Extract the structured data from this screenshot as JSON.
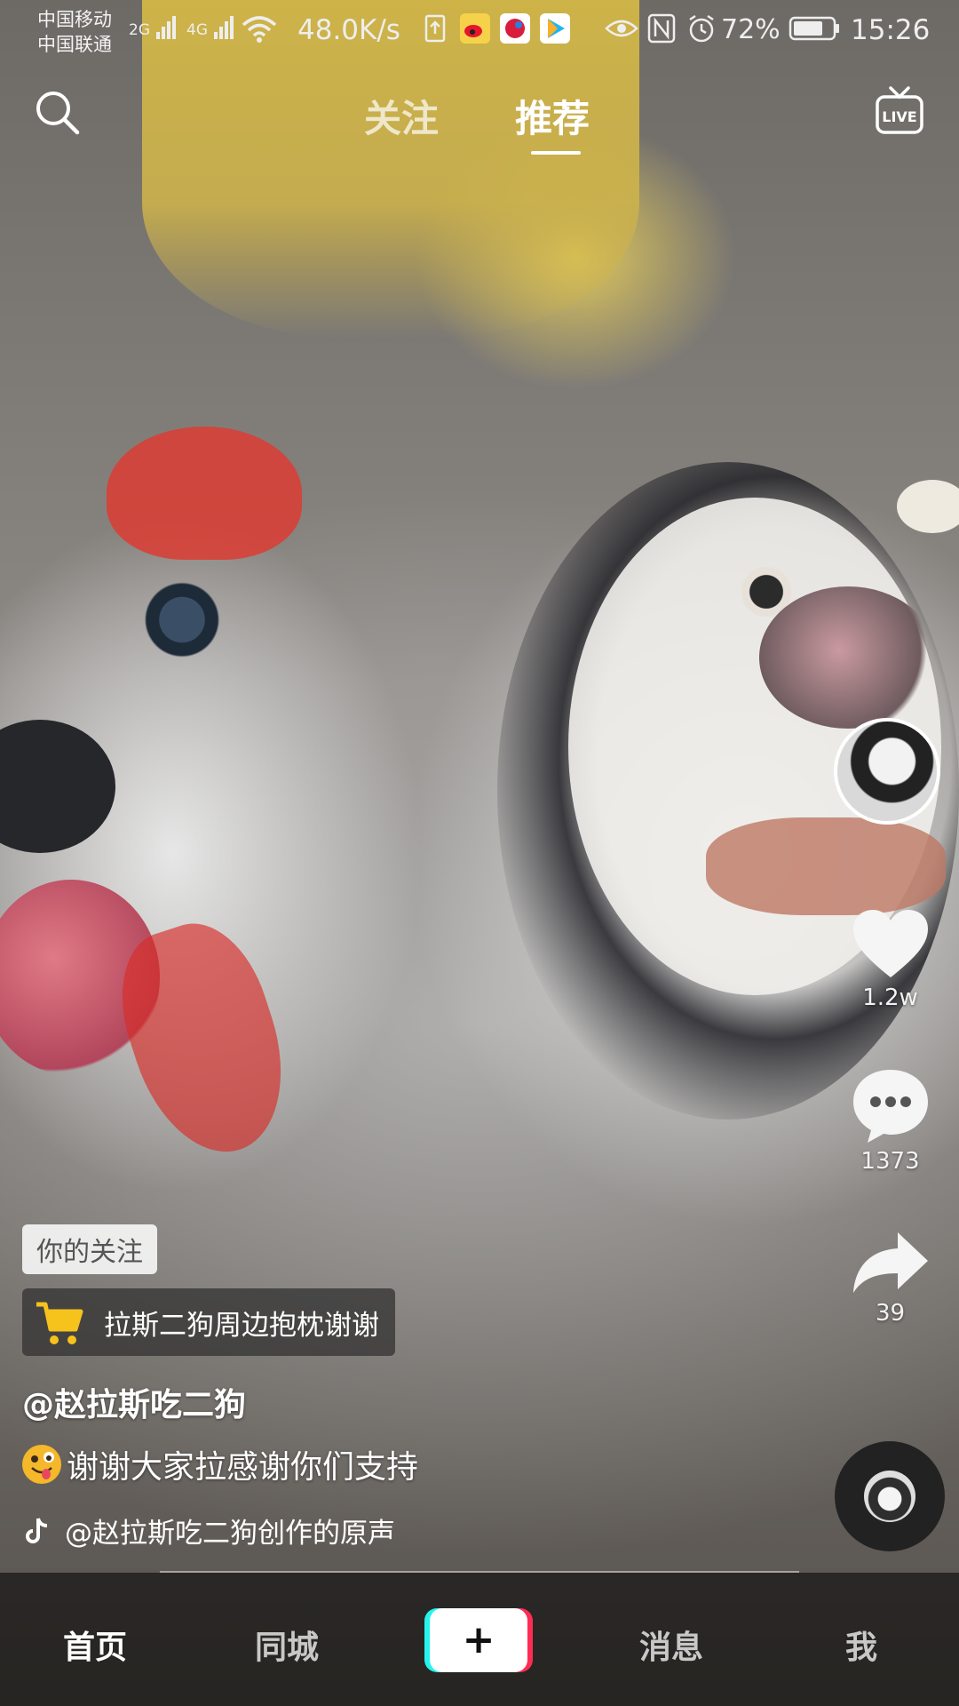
{
  "status_bar": {
    "carrier_1": "中国移动",
    "carrier_2": "中国联通",
    "sim1_net": "2G",
    "sim2_net": "4G",
    "net_speed": "48.0K/s",
    "battery_percent": "72%",
    "time": "15:26",
    "icons": [
      "wifi-icon",
      "upload-icon",
      "weibo-icon",
      "notification-app-icon",
      "video-app-icon",
      "eye-icon",
      "nfc-icon",
      "alarm-icon",
      "battery-icon"
    ]
  },
  "top_nav": {
    "tabs": [
      {
        "label": "关注",
        "active": false
      },
      {
        "label": "推荐",
        "active": true
      }
    ],
    "search_icon": "search-icon",
    "live_icon": "live-icon",
    "live_label": "LIVE"
  },
  "right_rail": {
    "like_count": "1.2w",
    "comment_count": "1373",
    "share_count": "39"
  },
  "video_info": {
    "follow_tag": "你的关注",
    "shop_label": "拉斯二狗周边抱枕谢谢",
    "username": "@赵拉斯吃二狗",
    "caption": "谢谢大家拉感谢你们支持",
    "music": "@赵拉斯吃二狗创作的原声"
  },
  "bottom_nav": {
    "home": "首页",
    "city": "同城",
    "add": "+",
    "messages": "消息",
    "me": "我"
  },
  "colors": {
    "accent_cyan": "#25f4ee",
    "accent_red": "#fe2c55",
    "cart_yellow": "#f6c21c"
  }
}
